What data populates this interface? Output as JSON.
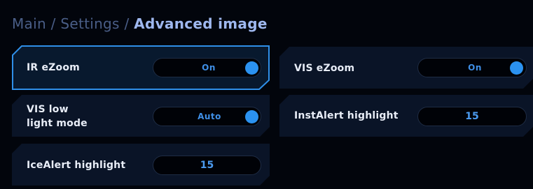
{
  "breadcrumb": {
    "main": "Main",
    "sep1": "/",
    "settings": "Settings",
    "sep2": "/",
    "current": "Advanced image"
  },
  "settings": {
    "ir_ezoom": {
      "label": "IR eZoom",
      "value": "On",
      "toggle_on": true
    },
    "vis_ezoom": {
      "label": "VIS eZoom",
      "value": "On",
      "toggle_on": true
    },
    "vis_low_light": {
      "label_line1": "VIS low",
      "label_line2": "light mode",
      "value": "Auto",
      "toggle_on": true
    },
    "instalert_highlight": {
      "label": "InstAlert highlight",
      "value": "15"
    },
    "icealert_highlight": {
      "label": "IceAlert highlight",
      "value": "15"
    }
  },
  "colors": {
    "accent": "#2b92f0",
    "tile_bg": "#0a1427",
    "selected_border": "#2f8fe8",
    "breadcrumb_muted": "#4a5e87",
    "breadcrumb_active": "#9fb8ef"
  }
}
